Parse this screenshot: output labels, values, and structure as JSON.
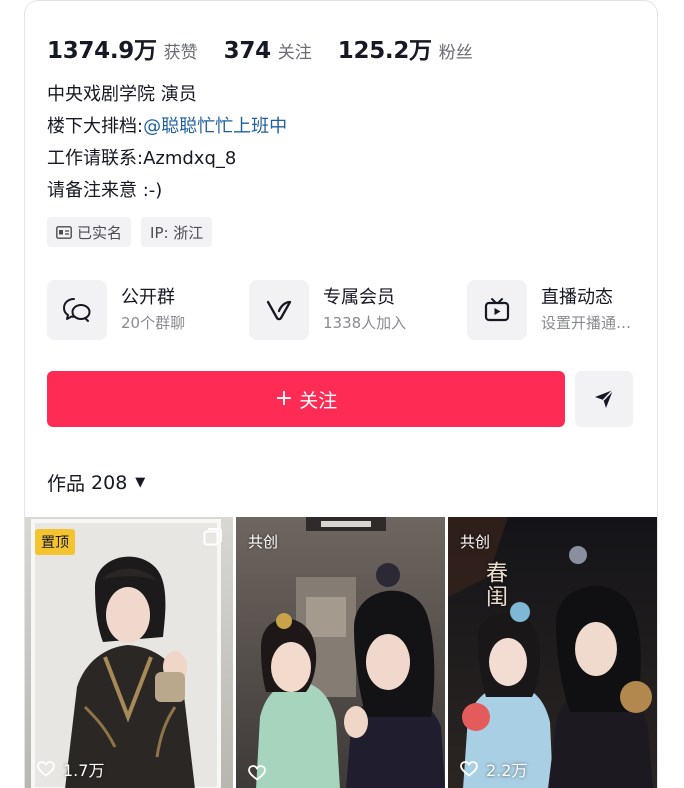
{
  "stats": [
    {
      "value": "1374.9万",
      "label": "获赞"
    },
    {
      "value": "374",
      "label": "关注"
    },
    {
      "value": "125.2万",
      "label": "粉丝"
    }
  ],
  "bio": {
    "line1": "中央戏剧学院 演员",
    "line2_prefix": "楼下大排档:",
    "line2_mention": "@聪聪忙忙上班中",
    "line3": "工作请联系:Azmdxq_8",
    "line4": "请备注来意 :-)"
  },
  "tags": {
    "verified": "已实名",
    "ip": "IP:  浙江"
  },
  "features": [
    {
      "title": "公开群",
      "subtitle": "20个群聊",
      "icon": "chat-bubbles-icon"
    },
    {
      "title": "专属会员",
      "subtitle": "1338人加入",
      "icon": "v-member-icon"
    },
    {
      "title": "直播动态",
      "subtitle": "设置开播通…",
      "icon": "tv-icon"
    }
  ],
  "actions": {
    "follow_plus": "+",
    "follow_label": "关注",
    "share_icon": "send-icon"
  },
  "works": {
    "label": "作品",
    "count": "208",
    "caret": "▼"
  },
  "grid": [
    {
      "badge": "置顶",
      "likes": "1.7万"
    },
    {
      "badge": "共创",
      "likes": ""
    },
    {
      "badge": "共创",
      "likes": "2.2万",
      "overlay_title": "春闺"
    }
  ],
  "colors": {
    "accent": "#fe2c55",
    "mention": "#1f5f9e",
    "pin_badge": "#f4c430"
  }
}
